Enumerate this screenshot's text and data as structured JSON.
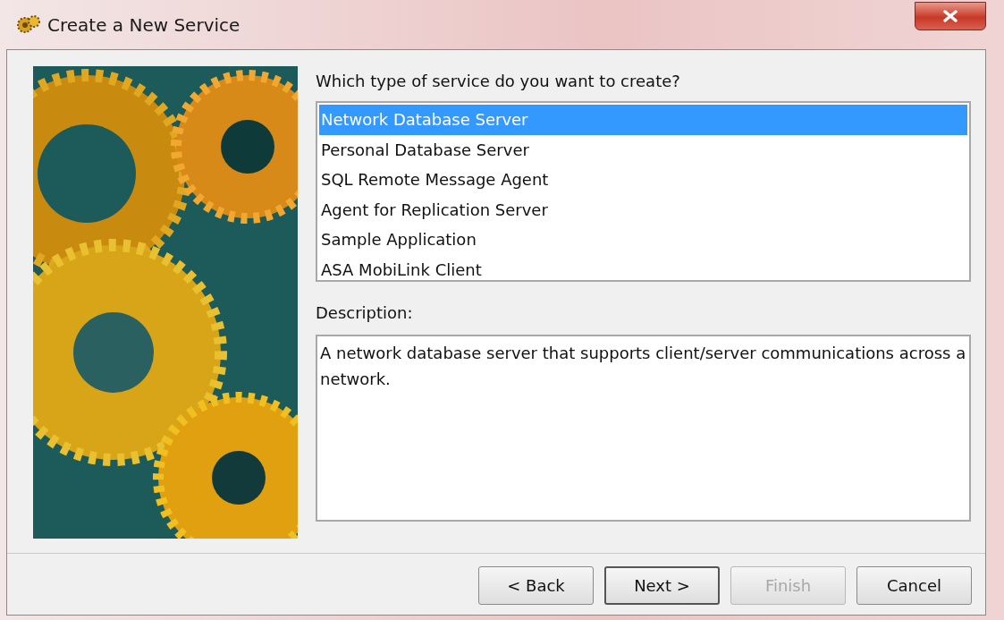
{
  "window": {
    "title": "Create a New Service"
  },
  "prompt": "Which type of service do you want to create?",
  "service_types": [
    {
      "label": "Network Database Server",
      "selected": true
    },
    {
      "label": "Personal Database Server",
      "selected": false
    },
    {
      "label": "SQL Remote Message Agent",
      "selected": false
    },
    {
      "label": "Agent for Replication Server",
      "selected": false
    },
    {
      "label": "Sample Application",
      "selected": false
    },
    {
      "label": "ASA MobiLink Client",
      "selected": false
    }
  ],
  "description": {
    "label": "Description:",
    "text": "A network database server that supports client/server communications across a network."
  },
  "buttons": [
    {
      "label": "< Back",
      "default": false,
      "disabled": false
    },
    {
      "label": "Next >",
      "default": true,
      "disabled": false
    },
    {
      "label": "Finish",
      "default": false,
      "disabled": true
    },
    {
      "label": "Cancel",
      "default": false,
      "disabled": false
    }
  ]
}
